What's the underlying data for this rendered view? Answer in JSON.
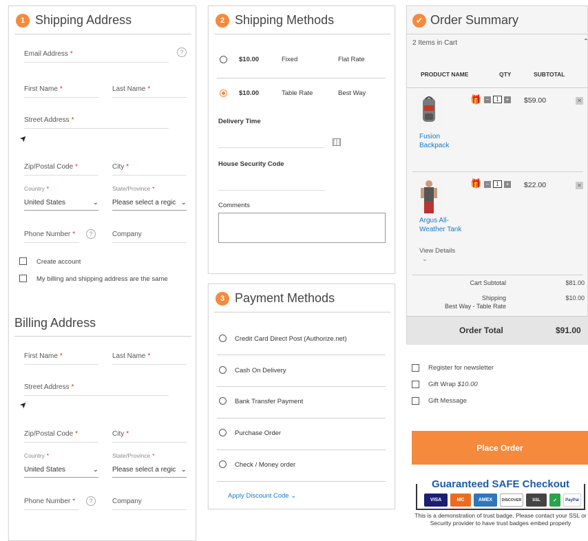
{
  "shipping_address": {
    "step": "1",
    "title": "Shipping Address",
    "email_label": "Email Address",
    "first_name_label": "First Name",
    "last_name_label": "Last Name",
    "street_label": "Street Address",
    "zip_label": "Zip/Postal Code",
    "city_label": "City",
    "country_label": "Country",
    "country_value": "United States",
    "state_label": "State/Province",
    "state_value": "Please select a regic",
    "phone_label": "Phone Number",
    "company_label": "Company",
    "create_account": "Create account",
    "same_address": "My billing and shipping address are the same",
    "required_mark": "*",
    "help_mark": "?"
  },
  "billing_address": {
    "title": "Billing Address",
    "first_name_label": "First Name",
    "last_name_label": "Last Name",
    "street_label": "Street Address",
    "zip_label": "Zip/Postal Code",
    "city_label": "City",
    "country_label": "Country",
    "country_value": "United States",
    "state_label": "State/Province",
    "state_value": "Please select a regic",
    "phone_label": "Phone Number",
    "company_label": "Company"
  },
  "shipping_methods": {
    "step": "2",
    "title": "Shipping Methods",
    "options": [
      {
        "price": "$10.00",
        "method": "Fixed",
        "carrier": "Flat Rate",
        "selected": false
      },
      {
        "price": "$10.00",
        "method": "Table Rate",
        "carrier": "Best Way",
        "selected": true
      }
    ],
    "delivery_time_label": "Delivery Time",
    "security_code_label": "House Security Code",
    "comments_label": "Comments"
  },
  "payment_methods": {
    "step": "3",
    "title": "Payment Methods",
    "options": [
      "Credit Card Direct Post (Authorize.net)",
      "Cash On Delivery",
      "Bank Transfer Payment",
      "Purchase Order",
      "Check / Money order"
    ],
    "discount_link": "Apply Discount Code"
  },
  "order_summary": {
    "title": "Order Summary",
    "items_in_cart": "2 Items in Cart",
    "col_product": "PRODUCT NAME",
    "col_qty": "QTY",
    "col_subtotal": "SUBTOTAL",
    "items": [
      {
        "name_line1": "Fusion",
        "name_line2": "Backpack",
        "qty": "1",
        "subtotal": "$59.00"
      },
      {
        "name_line1": "Argus All-",
        "name_line2": "Weather Tank",
        "qty": "1",
        "subtotal": "$22.00"
      }
    ],
    "view_details": "View Details",
    "cart_subtotal_label": "Cart Subtotal",
    "cart_subtotal_value": "$81.00",
    "shipping_label": "Shipping",
    "shipping_method": "Best Way - Table Rate",
    "shipping_value": "$10.00",
    "order_total_label": "Order Total",
    "order_total_value": "$91.00"
  },
  "extras": {
    "newsletter": "Register for newsletter",
    "gift_wrap": "Gift Wrap",
    "gift_wrap_price": "$10.00",
    "gift_message": "Gift Message"
  },
  "place_order": "Place Order",
  "trust_badge": {
    "title": "Guaranteed SAFE Checkout",
    "cards": [
      "VISA",
      "MC",
      "AMEX",
      "DISCOVER",
      "SSL",
      "✓",
      "PayPal"
    ],
    "text": "This is a demonstration of trust badge. Please contact your SSL or Security provider to have trust badges embed properly"
  },
  "colors": {
    "accent": "#f58a3c",
    "link": "#1979c3",
    "required": "#e02b27"
  }
}
